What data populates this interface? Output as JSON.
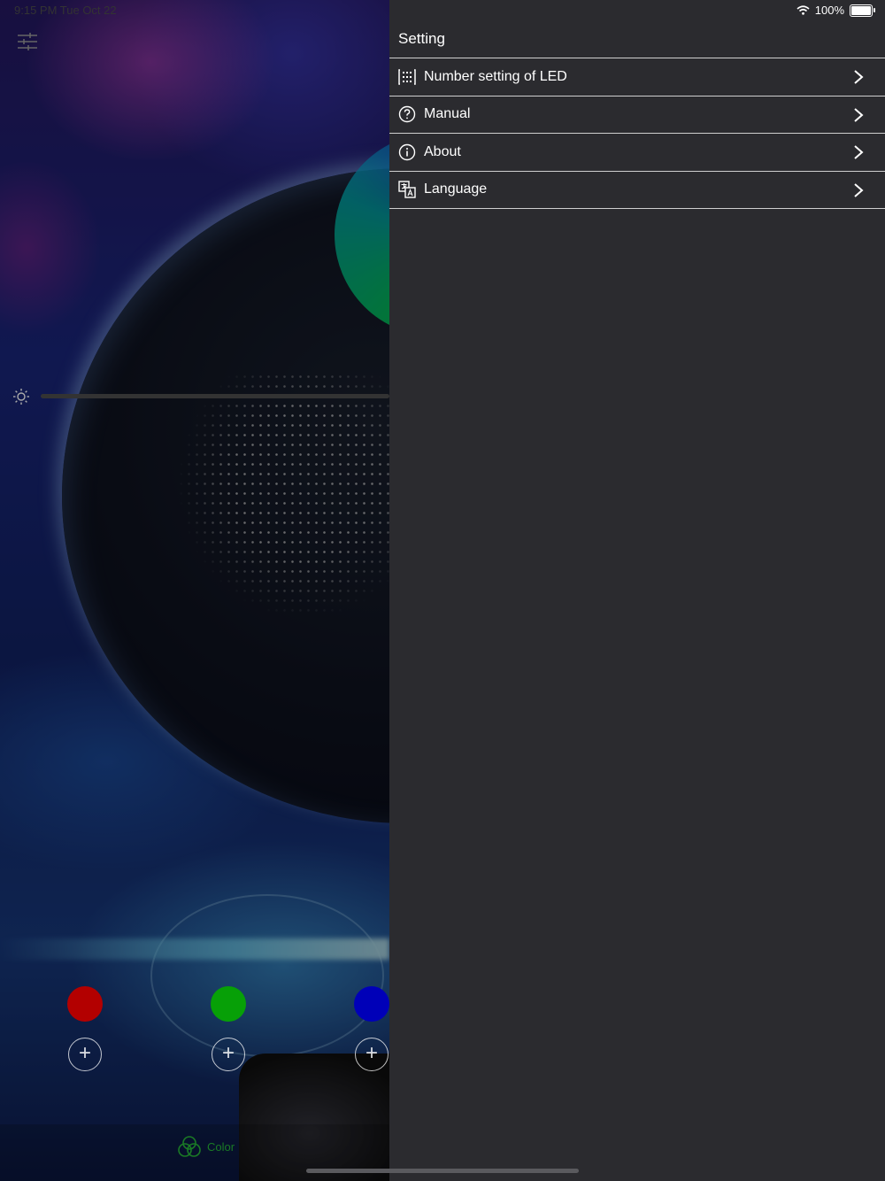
{
  "status": {
    "time_date": "9:15 PM  Tue Oct 22",
    "battery": "100%"
  },
  "drawer": {
    "title": "Setting",
    "items": [
      {
        "label": "Number setting of LED",
        "icon": "led-grid-icon"
      },
      {
        "label": "Manual",
        "icon": "question-circle-icon"
      },
      {
        "label": "About",
        "icon": "info-circle-icon"
      },
      {
        "label": "Language",
        "icon": "translate-icon"
      }
    ]
  },
  "main": {
    "tabbar": {
      "color_tab_label": "Color"
    },
    "color_dots": [
      {
        "color": "#b30000"
      },
      {
        "color": "#07a007"
      },
      {
        "color": "#0000b8"
      }
    ]
  },
  "colors": {
    "drawer_bg": "#2b2b2f",
    "divider": "#cfcfcf",
    "accent_green": "#1a7a25"
  }
}
